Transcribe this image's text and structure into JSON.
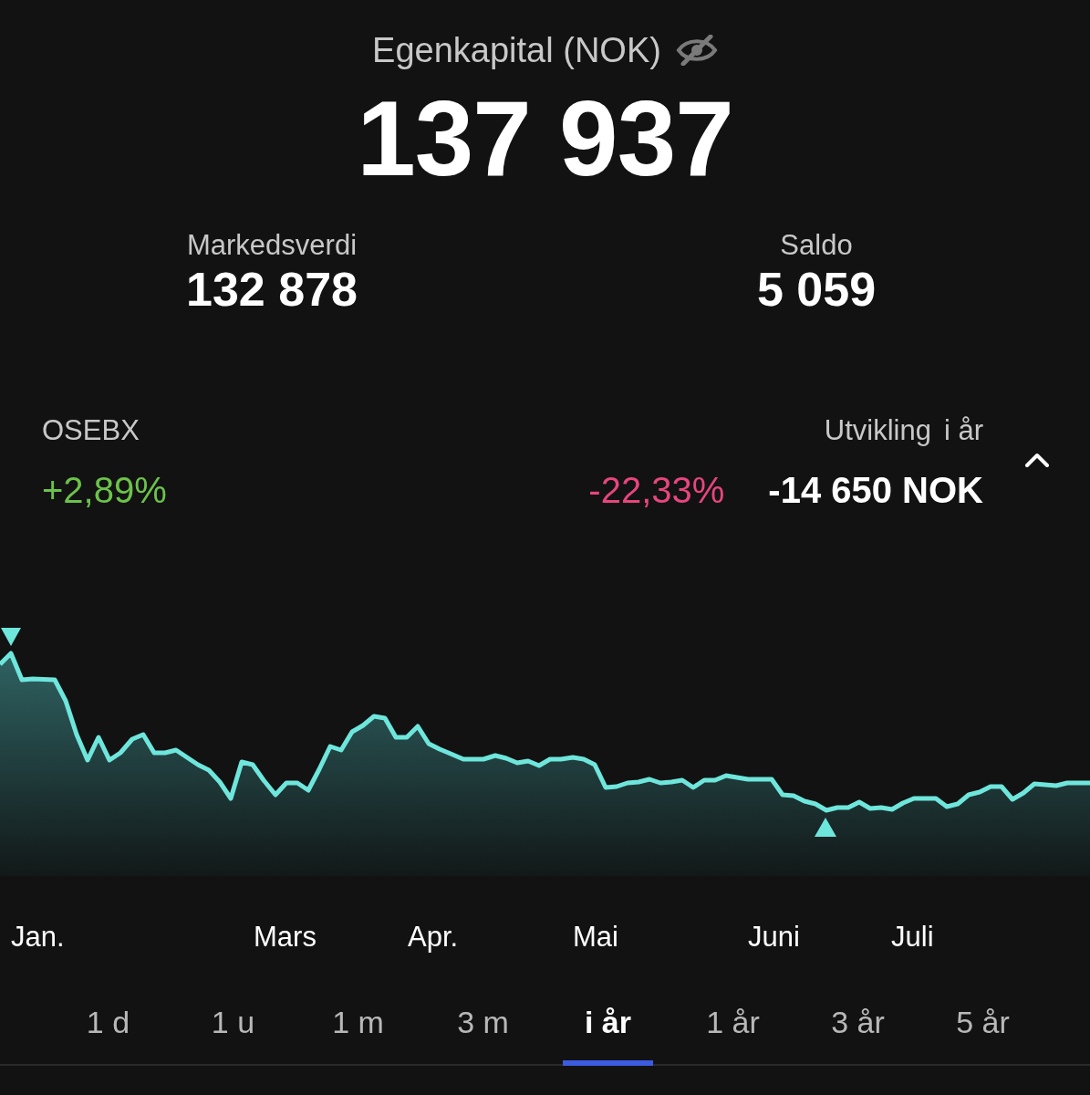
{
  "header": {
    "title": "Egenkapital (NOK)",
    "value": "137 937"
  },
  "summary": [
    {
      "label": "Markedsverdi",
      "value": "132 878"
    },
    {
      "label": "Saldo",
      "value": "5 059"
    }
  ],
  "benchmark": {
    "label": "OSEBX",
    "change": "+2,89%",
    "positive": true
  },
  "performance": {
    "label": "Utvikling",
    "period": "i år",
    "change_percent": "-22,33%",
    "change_amount": "-14 650 NOK",
    "positive": false,
    "expanded": true
  },
  "chart": {
    "x_labels": [
      "Jan.",
      "Mars",
      "Apr.",
      "Mai",
      "Juni",
      "Juli"
    ]
  },
  "periods": [
    {
      "label": "1 d",
      "selected": false
    },
    {
      "label": "1 u",
      "selected": false
    },
    {
      "label": "1 m",
      "selected": false
    },
    {
      "label": "3 m",
      "selected": false
    },
    {
      "label": "i år",
      "selected": true
    },
    {
      "label": "1 år",
      "selected": false
    },
    {
      "label": "3 år",
      "selected": false
    },
    {
      "label": "5 år",
      "selected": false
    }
  ]
}
